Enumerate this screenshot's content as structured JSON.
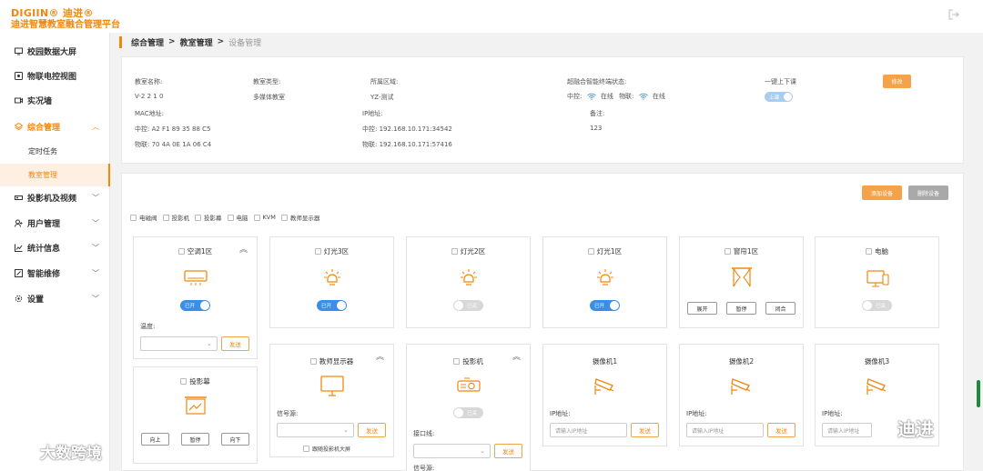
{
  "app": {
    "brand": "DIGIIN® 迪进®",
    "title": "迪进智慧教室融合管理平台"
  },
  "sidebar": {
    "items": [
      {
        "label": "校园数据大屏",
        "icon": "monitor-icon"
      },
      {
        "label": "物联电控视图",
        "icon": "iot-icon"
      },
      {
        "label": "实况墙",
        "icon": "video-icon"
      },
      {
        "label": "综合管理",
        "icon": "layers-icon",
        "expanded": true
      },
      {
        "label": "投影机及视频",
        "icon": "projector-icon"
      },
      {
        "label": "用户管理",
        "icon": "users-icon"
      },
      {
        "label": "统计信息",
        "icon": "chart-icon"
      },
      {
        "label": "智能维修",
        "icon": "tools-icon"
      },
      {
        "label": "设置",
        "icon": "settings-icon"
      }
    ],
    "sub_items": [
      {
        "label": "定时任务"
      },
      {
        "label": "教室管理",
        "active": true
      }
    ]
  },
  "breadcrumb": [
    "综合管理",
    "教室管理",
    "设备管理"
  ],
  "info": {
    "room_name_label": "教室名称:",
    "room_name": "V-2 2 1 0",
    "room_type_label": "教室类型:",
    "room_type": "多媒体教室",
    "area_label": "所属区域:",
    "area": "YZ-测试",
    "terminal_status_label": "超融合智能终端状态:",
    "central_label": "中控:",
    "central_status": "在线",
    "iot_label": "物联:",
    "iot_status": "在线",
    "one_key_label": "一键上下课",
    "one_key_state": "上课",
    "edit_button": "修改",
    "mac_label": "MAC地址:",
    "mac_central": "中控:  A2 F1 89 35 88 C5",
    "mac_iot": "物联: 70 4A 0E 1A 06 C4",
    "ip_label": "IP地址:",
    "ip_central": "中控:  192.168.10.171:34542",
    "ip_iot": "物联: 192.168.10.171:57416",
    "note_label": "备注:",
    "note": "123"
  },
  "devices": {
    "add_button": "添加设备",
    "delete_button": "删除设备",
    "filters": [
      "电磁阀",
      "投影机",
      "投影幕",
      "电脑",
      "KVM",
      "教师显示器"
    ],
    "cards": {
      "ac": {
        "title": "空调1区",
        "toggle": "已开",
        "temp_label": "温度:",
        "send": "发送"
      },
      "light3": {
        "title": "灯光3区",
        "toggle": "已开"
      },
      "light2": {
        "title": "灯光2区",
        "toggle": "已关"
      },
      "light1": {
        "title": "灯光1区",
        "toggle": "已开"
      },
      "curtain": {
        "title": "窗帘1区",
        "open": "展开",
        "pause": "暂停",
        "close": "闭合"
      },
      "pc": {
        "title": "电脑",
        "toggle": "已关"
      },
      "screen": {
        "title": "投影幕",
        "up": "向上",
        "pause": "暂停",
        "down": "向下"
      },
      "monitor": {
        "title": "教师显示器",
        "signal_label": "信号源:",
        "send": "发送",
        "follow": "跟随投影机大屏"
      },
      "projector": {
        "title": "投影机",
        "toggle": "已关",
        "port_label": "接口线:",
        "send": "发送",
        "signal_label": "信号源:"
      },
      "cam1": {
        "title": "摄像机1",
        "ip_label": "IP地址:",
        "placeholder": "请输入IP地址",
        "send": "发送"
      },
      "cam2": {
        "title": "摄像机2",
        "ip_label": "IP地址:",
        "placeholder": "请输入IP地址",
        "send": "发送"
      },
      "cam3": {
        "title": "摄像机3",
        "ip_label": "IP地址:",
        "placeholder": "请输入IP地址"
      }
    }
  },
  "watermarks": {
    "left": "大数跨境",
    "right": "迪进"
  },
  "colors": {
    "accent": "#f0870f",
    "toggle_on": "#3b8ee7",
    "toggle_off": "#d8d8d8"
  }
}
